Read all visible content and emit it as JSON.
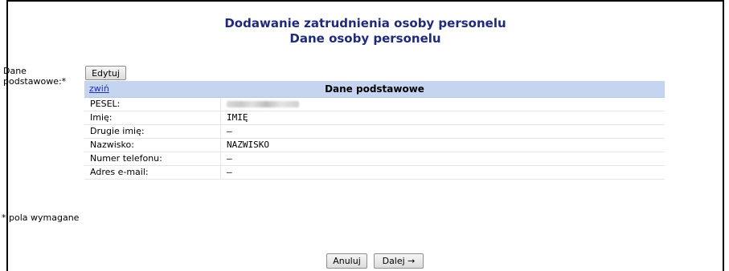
{
  "header": {
    "title_line1": "Dodawanie zatrudnienia osoby personelu",
    "title_line2": "Dane osoby personelu"
  },
  "form": {
    "field_label_line1": "Dane",
    "field_label_line2": "podstawowe:*",
    "edit_button": "Edytuj",
    "panel": {
      "collapse_link": "zwiń",
      "title": "Dane podstawowe",
      "rows": [
        {
          "label": "PESEL:",
          "value": ""
        },
        {
          "label": "Imię:",
          "value": "IMIĘ"
        },
        {
          "label": "Drugie imię:",
          "value": "–"
        },
        {
          "label": "Nazwisko:",
          "value": "NAZWISKO"
        },
        {
          "label": "Numer telefonu:",
          "value": "–"
        },
        {
          "label": "Adres e-mail:",
          "value": "–"
        }
      ]
    }
  },
  "footer": {
    "required_note": "* pola wymagane",
    "cancel_button": "Anuluj",
    "next_button": "Dalej →"
  }
}
